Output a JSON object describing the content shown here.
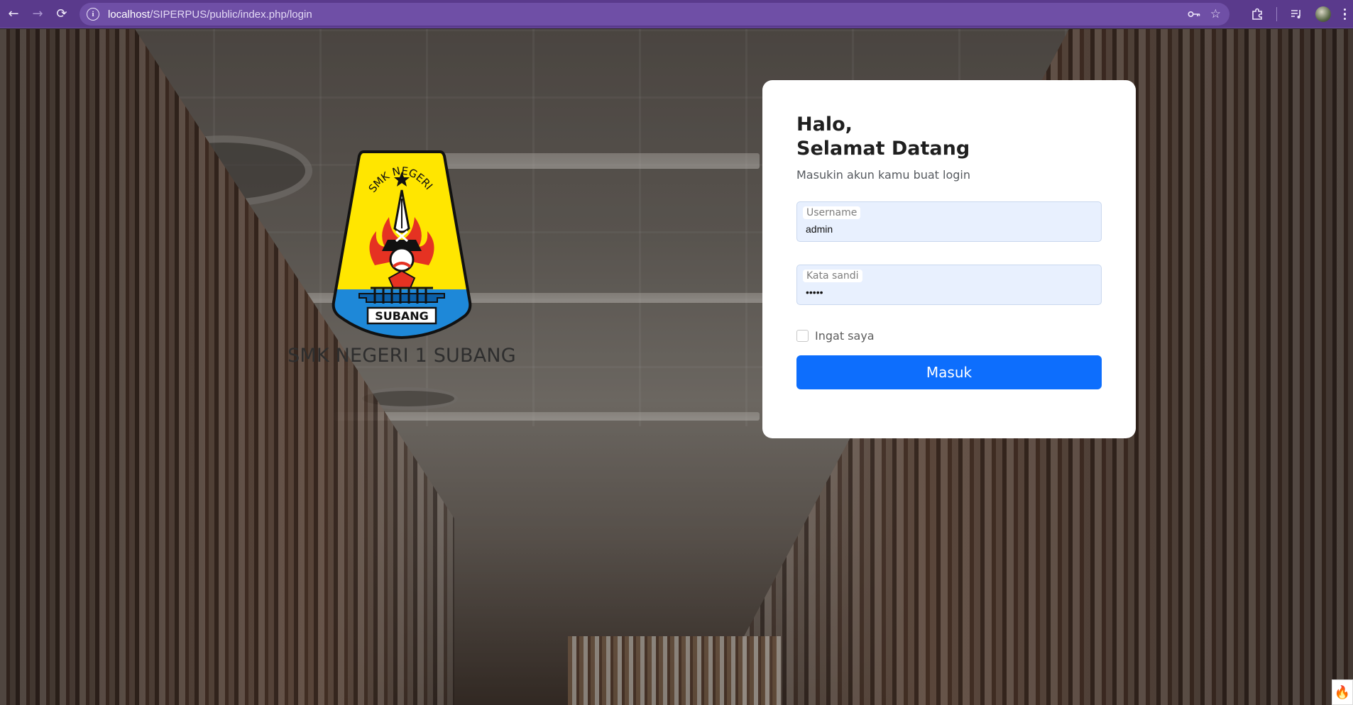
{
  "browser": {
    "url_host": "localhost",
    "url_path": "/SIPERPUS/public/index.php/login",
    "icons": {
      "back": "arrow-left-icon",
      "forward": "arrow-right-icon",
      "reload": "reload-icon",
      "site_info": "info-icon",
      "password": "key-icon",
      "bookmark": "star-icon",
      "extensions": "puzzle-icon",
      "media": "media-controls-icon",
      "menu": "kebab-menu-icon"
    }
  },
  "brand": {
    "school_name": "SMK NEGERI 1 SUBANG",
    "emblem_arc_text": "SMK NEGERI 1",
    "emblem_banner_text": "SUBANG"
  },
  "login": {
    "greeting_line1": "Halo,",
    "greeting_line2": "Selamat Datang",
    "subtitle": "Masukin akun kamu buat login",
    "username_label": "Username",
    "username_value": "admin",
    "password_label": "Kata sandi",
    "password_value": "admin",
    "remember_label": "Ingat saya",
    "submit_label": "Masuk"
  },
  "colors": {
    "browser_frame": "#5a3a8c",
    "primary_button": "#0d6efd",
    "input_fill": "#e8f0fe",
    "emblem_yellow": "#ffe600",
    "emblem_blue": "#1e88d8",
    "emblem_red": "#e53222"
  }
}
